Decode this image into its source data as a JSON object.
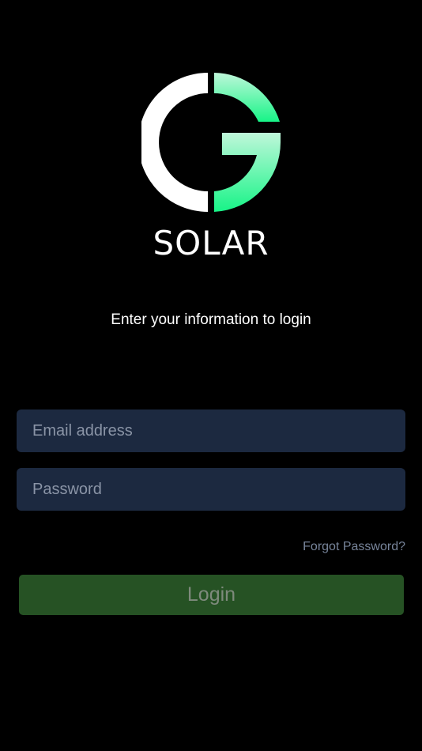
{
  "brand": {
    "name": "SOLAR",
    "logo_icon": "solar-g-logo-icon",
    "colors": {
      "ring_left": "#ffffff",
      "ring_right_top": "#b7f6d6",
      "ring_right_bottom": "#1ef58b"
    }
  },
  "login": {
    "subtitle": "Enter your information to login",
    "email_placeholder": "Email address",
    "email_value": "",
    "password_placeholder": "Password",
    "password_value": "",
    "forgot_password_label": "Forgot Password?",
    "login_button_label": "Login"
  },
  "colors": {
    "background": "#000000",
    "input_background": "#1c2940",
    "button_background": "#265224",
    "link_color": "#77849a"
  }
}
